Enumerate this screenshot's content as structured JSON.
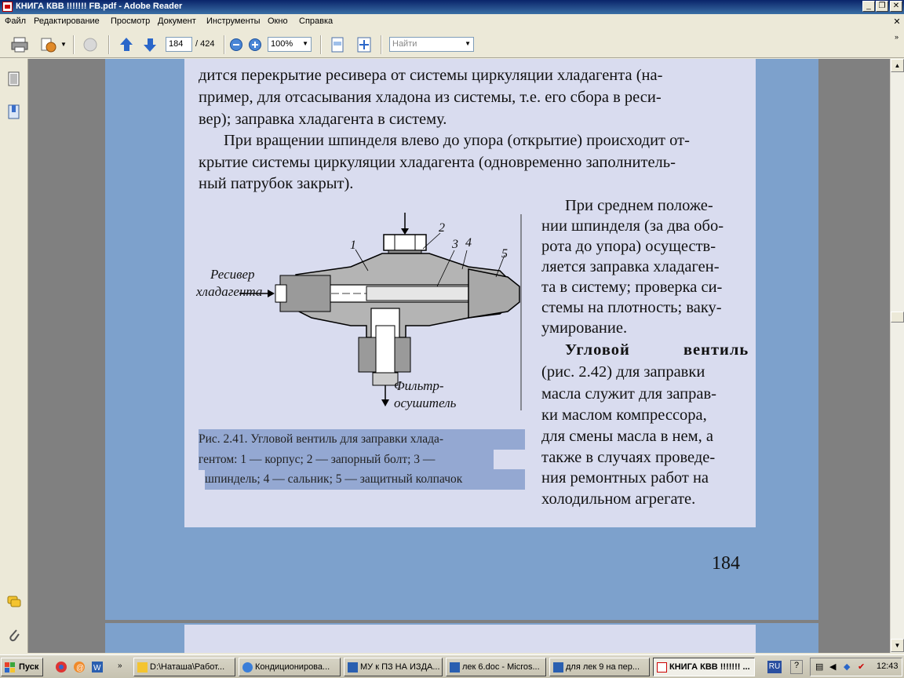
{
  "window": {
    "title": "КНИГА КВВ !!!!!!! FB.pdf - Adobe Reader"
  },
  "menu": {
    "items": [
      "Файл",
      "Редактирование",
      "Просмотр",
      "Документ",
      "Инструменты",
      "Окно",
      "Справка"
    ]
  },
  "toolbar": {
    "page_number": "184",
    "page_total": "/ 424",
    "zoom": "100%",
    "find_placeholder": "Найти"
  },
  "page": {
    "paragraph1_lines": [
      "дится перекрытие ресивера от системы циркуляции хладагента (на-",
      "пример, для отсасывания хладона из системы, т.е. его сбора в реси-",
      "вер); заправка хладагента в систему."
    ],
    "paragraph2_lines": [
      "При вращении шпинделя влево до упора (открытие) происходит от-",
      "крытие системы циркуляции хладагента (одновременно заполнитель-",
      "ный патрубок закрыт)."
    ],
    "side_lines": [
      "При среднем положе-",
      "нии шпинделя (за два обо-",
      "рота до упора) осуществ-",
      "ляется заправка хладаген-",
      "та в систему; проверка си-",
      "стемы на плотность; ваку-",
      "умирование."
    ],
    "side2_heading": "Угловой вентиль",
    "side2_lines": [
      "(рис. 2.42) для заправки",
      "масла служит для заправ-",
      "ки маслом компрессора,",
      "для смены масла в нем, а",
      "также в случаях проведе-",
      "ния ремонтных работ на",
      "холодильном агрегате."
    ],
    "figure": {
      "label_receiver_1": "Ресивер",
      "label_receiver_2": "хладагента",
      "label_filter_1": "Фильтр-",
      "label_filter_2": "осушитель",
      "callouts": [
        "1",
        "2",
        "3",
        "4",
        "5"
      ]
    },
    "caption_lines": [
      "Рис. 2.41. Угловой вентиль для заправки хлада-",
      "гентом: 1 — корпус; 2 — запорный болт; 3 —",
      "шпиндель; 4 — сальник; 5 — защитный колпачок"
    ],
    "page_number": "184"
  },
  "taskbar": {
    "start": "Пуск",
    "tasks": [
      "D:\\Наташа\\Работ...",
      "Кондиционирова...",
      "МУ к ПЗ НА ИЗДА...",
      "лек 6.doc - Micros...",
      "для лек 9 на пер...",
      "КНИГА КВВ !!!!!!! ..."
    ],
    "language": "RU",
    "clock": "12:43"
  }
}
